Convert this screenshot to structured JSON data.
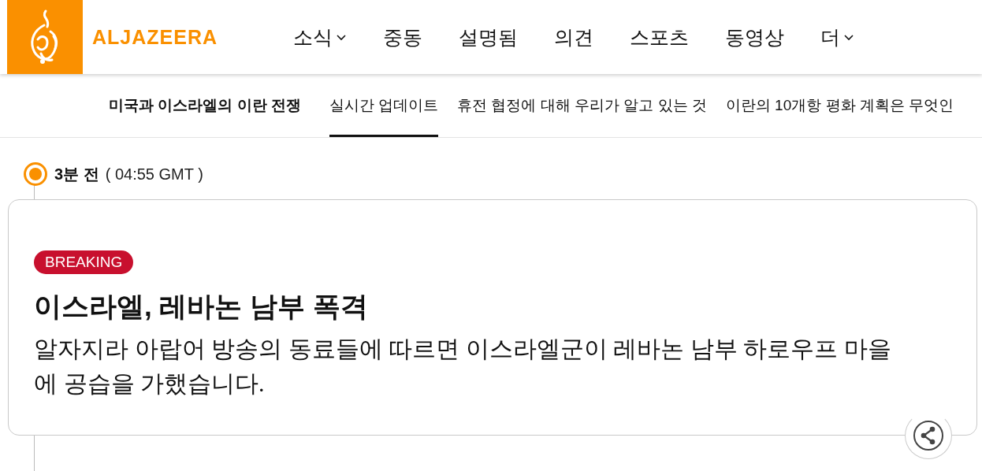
{
  "header": {
    "logo": {
      "wordmark": "ALJAZEERA"
    },
    "nav": [
      {
        "label": "소식",
        "dropdown": true
      },
      {
        "label": "중동",
        "dropdown": false
      },
      {
        "label": "설명됨",
        "dropdown": false
      },
      {
        "label": "의견",
        "dropdown": false
      },
      {
        "label": "스포츠",
        "dropdown": false
      },
      {
        "label": "동영상",
        "dropdown": false
      },
      {
        "label": "더",
        "dropdown": true
      }
    ]
  },
  "subnav": {
    "title": "미국과 이스라엘의 이란 전쟁",
    "items": [
      {
        "label": "실시간 업데이트",
        "selected": true
      },
      {
        "label": "휴전 협정에 대해 우리가 알고 있는 것",
        "selected": false
      },
      {
        "label": "이란의 10개항 평화 계획은 무엇인",
        "selected": false
      }
    ]
  },
  "timeline": [
    {
      "age": "3분 전",
      "time": "( 04:55 GMT )",
      "badge": "BREAKING",
      "headline": "이스라엘, 레바논 남부 폭격",
      "body": "알자지라 아랍어 방송의 동료들에 따르면 이스라엘군이 레바논 남부 하로우프 마을에 공습을 가했습니다."
    }
  ]
}
